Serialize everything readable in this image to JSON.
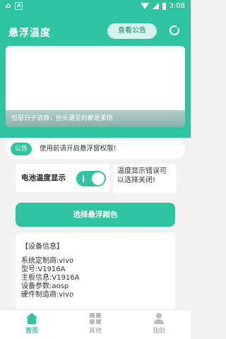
{
  "status_bar": {
    "time": "3:08",
    "left_icons": [
      "app-icon",
      "a-icon"
    ],
    "right_icons": [
      "wifi-icon",
      "signal-icon",
      "battery-icon"
    ]
  },
  "header": {
    "title": "悬浮温度",
    "notice_button": "查看公告",
    "settings_icon": "settings-icon"
  },
  "banner": {
    "caption": "但愿日子清静，抬头遇见的都是柔情"
  },
  "notice": {
    "tag": "公告",
    "text": "使用前请开启悬浮窗权限!"
  },
  "toggle": {
    "label": "电池温度显示",
    "on": true
  },
  "hint": {
    "text": "温度显示错误可以选择关闭!"
  },
  "choose_color_button": "选择悬浮颜色",
  "device_info": {
    "title": "【设备信息】",
    "lines": [
      "系统定制商:vivo",
      "型号:V1916A",
      "主板信息:V1916A",
      "设备参数:aosp",
      "硬件制造商:vivo"
    ]
  },
  "tabbar": {
    "tabs": [
      {
        "label": "首页",
        "icon": "home-icon",
        "active": true
      },
      {
        "label": "其他",
        "icon": "grid-icon",
        "active": false
      },
      {
        "label": "我的",
        "icon": "user-icon",
        "active": false
      }
    ]
  },
  "colors": {
    "primary": "#2ec4a0",
    "background": "#f2f2f2"
  }
}
